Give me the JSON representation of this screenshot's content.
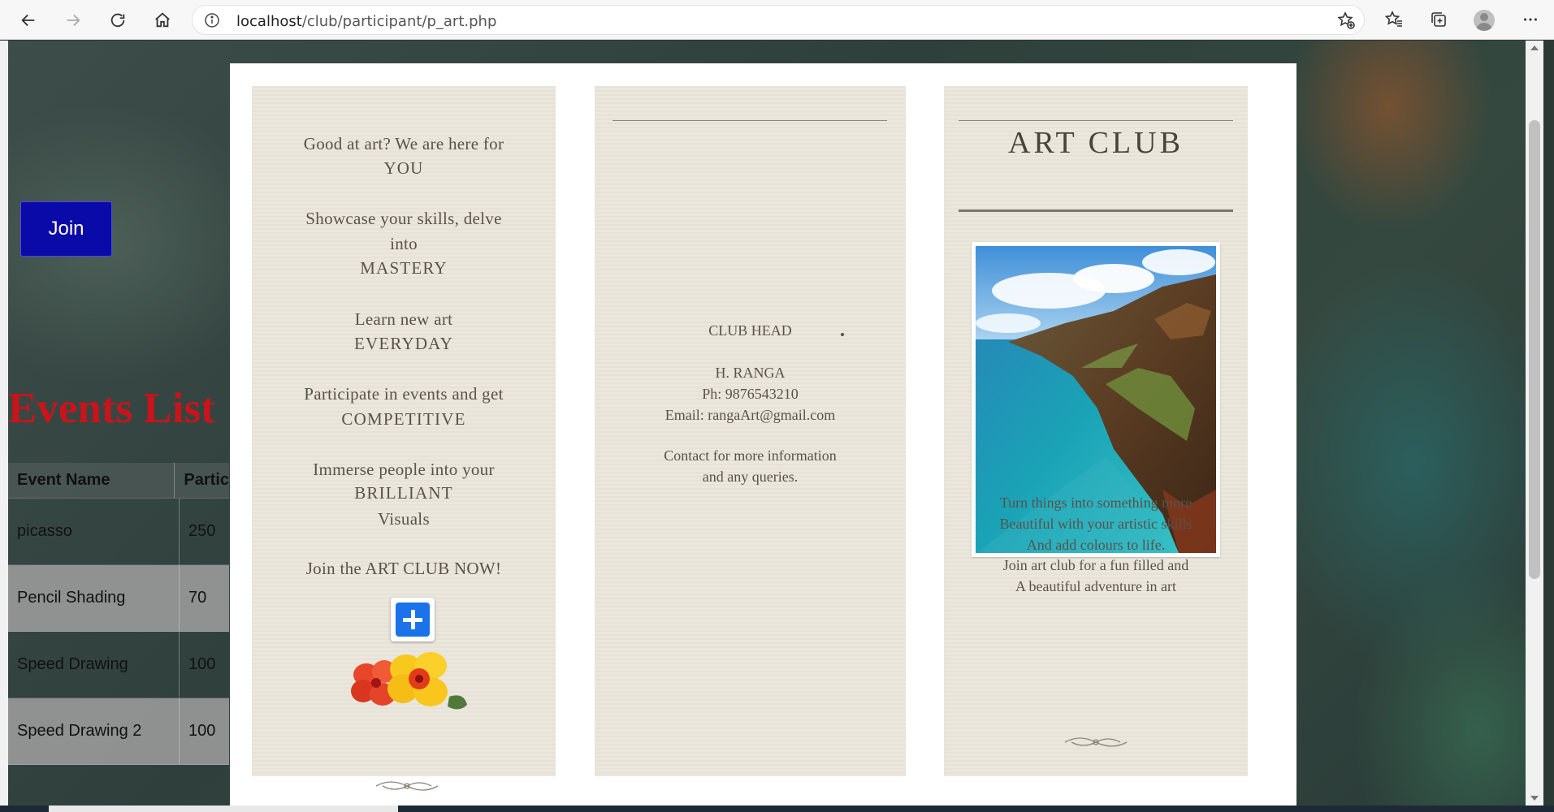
{
  "browser": {
    "url_host": "localhost",
    "url_path": "/club/participant/p_art.php"
  },
  "page": {
    "join_label": "Join",
    "events_title": "Events List",
    "events_table": {
      "headers": [
        "Event Name",
        "Partic"
      ],
      "rows": [
        [
          "picasso",
          "250"
        ],
        [
          "Pencil Shading",
          "70"
        ],
        [
          "Speed Drawing",
          "100"
        ],
        [
          "Speed Drawing 2",
          "100"
        ]
      ]
    }
  },
  "brochure": {
    "panel1": {
      "line1": "Good at art? We are here for",
      "line2": "YOU",
      "line3": "Showcase your skills, delve",
      "line4": "into",
      "line5": "MASTERY",
      "line6": "Learn new art",
      "line7": "EVERYDAY",
      "line8": "Participate in events and get",
      "line9": "COMPETITIVE",
      "line10": "Immerse people into your",
      "line11": "BRILLIANT",
      "line12": "Visuals",
      "line13": "Join the ART CLUB NOW!"
    },
    "panel2": {
      "club_head_label": "CLUB HEAD",
      "head_name": "H. RANGA",
      "phone": "Ph: 9876543210",
      "email": "Email:  rangaArt@gmail.com",
      "contact_line1": "Contact for more information",
      "contact_line2": "and any queries."
    },
    "panel3": {
      "title": "ART CLUB",
      "line1": "Turn things into something more",
      "line2": "Beautiful with your artistic skills",
      "line3": "And add colours to life.",
      "line4": "Join art club for a fun filled and",
      "line5": "A beautiful adventure in art"
    }
  },
  "icons": {
    "back": "arrow-left-icon",
    "forward": "arrow-right-icon",
    "reload": "reload-icon",
    "home": "home-icon",
    "info": "info-icon",
    "add_favorite": "star-plus-icon",
    "favorites": "favorites-icon",
    "collections": "collections-icon",
    "profile": "avatar-icon",
    "more": "more-icon",
    "join_plus": "plus-icon"
  },
  "colors": {
    "join_button": "#0a0aa8",
    "events_title": "#c8141a",
    "brochure_panel": "#ebe7dd",
    "plus_button": "#1a73e8"
  }
}
